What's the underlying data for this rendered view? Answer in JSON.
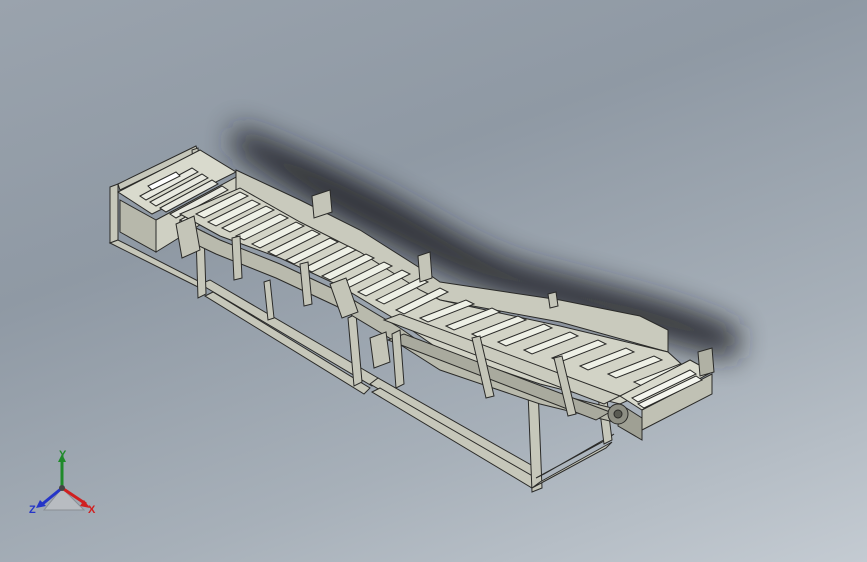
{
  "viewport": {
    "background_top": "#9aa3ad",
    "background_bottom": "#c4cbd2"
  },
  "model": {
    "frame_color": "#c6c7ba",
    "frame_stroke": "#2a2a28",
    "slat_color": "#e8e9e0",
    "shadow_color": "#1b1d20"
  },
  "triad": {
    "x_label": "X",
    "y_label": "Y",
    "z_label": "Z",
    "x_color": "#d02020",
    "y_color": "#1f8a2a",
    "z_color": "#2535c8"
  }
}
